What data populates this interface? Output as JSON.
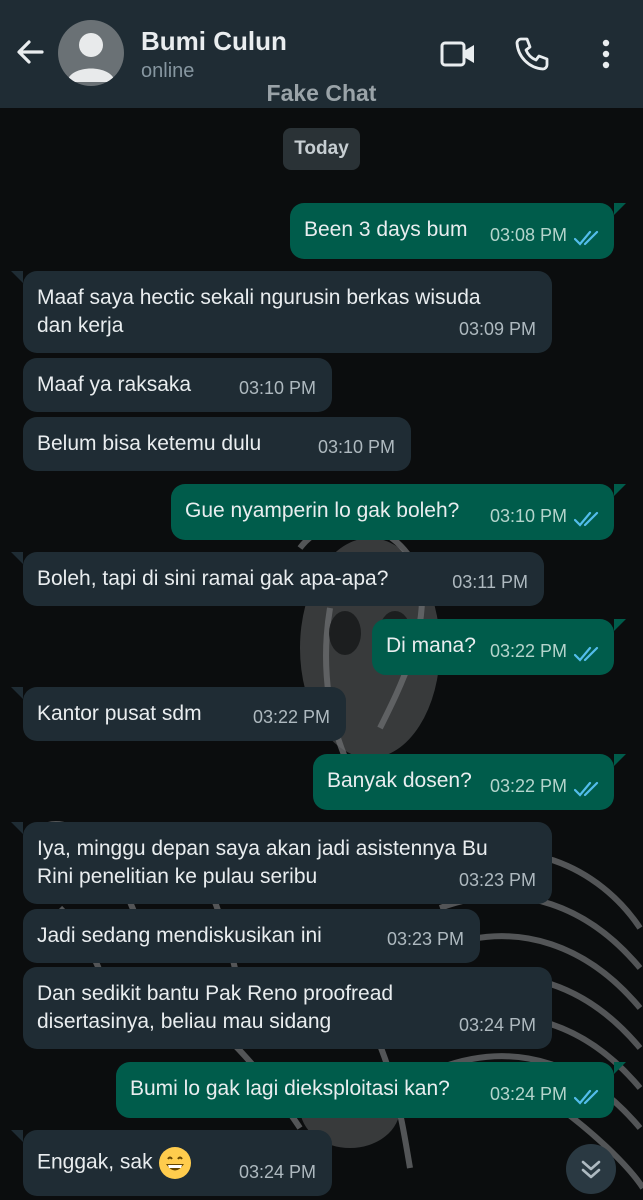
{
  "header": {
    "contact_name": "Bumi Culun",
    "contact_status": "online",
    "watermark": "Fake Chat"
  },
  "date_chip": "Today",
  "colors": {
    "header_bg": "#1f2c34",
    "incoming_bubble": "#1f2c34",
    "outgoing_bubble": "#005c4b",
    "read_ticks": "#53bdeb"
  },
  "messages": [
    {
      "dir": "out",
      "text": "Been 3 days bum",
      "time": "03:08 PM"
    },
    {
      "dir": "in",
      "text": [
        "Maaf saya hectic sekali ngurusin berkas wisuda",
        "dan kerja"
      ],
      "time": "03:09 PM"
    },
    {
      "dir": "in",
      "text": "Maaf ya raksaka",
      "time": "03:10 PM"
    },
    {
      "dir": "in",
      "text": "Belum bisa ketemu dulu",
      "time": "03:10 PM"
    },
    {
      "dir": "out",
      "text": "Gue nyamperin lo gak boleh?",
      "time": "03:10 PM"
    },
    {
      "dir": "in",
      "text": "Boleh, tapi di sini ramai gak apa-apa?",
      "time": "03:11 PM"
    },
    {
      "dir": "out",
      "text": "Di mana?",
      "time": "03:22 PM"
    },
    {
      "dir": "in",
      "text": "Kantor pusat sdm",
      "time": "03:22 PM"
    },
    {
      "dir": "out",
      "text": "Banyak dosen?",
      "time": "03:22 PM"
    },
    {
      "dir": "in",
      "text": [
        "Iya, minggu depan saya akan jadi asistennya Bu",
        "Rini penelitian ke pulau seribu"
      ],
      "time": "03:23 PM"
    },
    {
      "dir": "in",
      "text": "Jadi sedang mendiskusikan ini",
      "time": "03:23 PM"
    },
    {
      "dir": "in",
      "text": [
        "Dan sedikit bantu Pak Reno proofread",
        "disertasinya, beliau mau sidang"
      ],
      "time": "03:24 PM"
    },
    {
      "dir": "out",
      "text": "Bumi lo gak lagi dieksploitasi kan?",
      "time": "03:24 PM"
    },
    {
      "dir": "in",
      "text": "Enggak, sak",
      "emoji": "grinning-face",
      "time": "03:24 PM"
    }
  ]
}
